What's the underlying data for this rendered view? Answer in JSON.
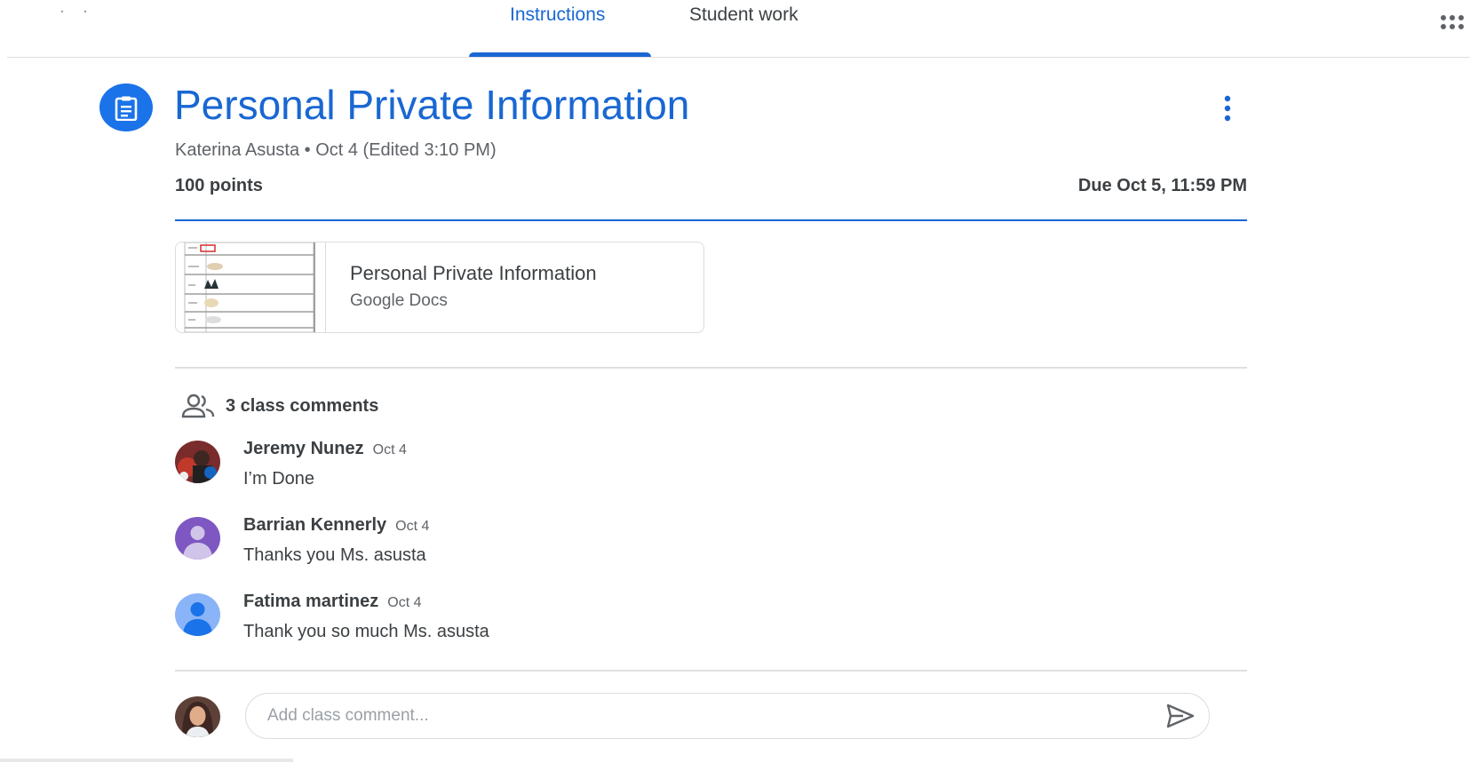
{
  "tabs": {
    "instructions": "Instructions",
    "student_work": "Student work"
  },
  "assignment": {
    "title": "Personal Private Information",
    "byline": "Katerina Asusta • Oct 4 (Edited 3:10 PM)",
    "points": "100 points",
    "due": "Due Oct 5, 11:59 PM"
  },
  "attachment": {
    "title": "Personal Private Information",
    "type": "Google Docs"
  },
  "comments": {
    "header": "3 class comments",
    "items": [
      {
        "author": "Jeremy Nunez",
        "date": "Oct 4",
        "text": "I’m Done"
      },
      {
        "author": "Barrian Kennerly",
        "date": "Oct 4",
        "text": "Thanks you  Ms. asusta"
      },
      {
        "author": "Fatima martinez",
        "date": "Oct 4",
        "text": "Thank you so much Ms. asusta"
      }
    ]
  },
  "composer": {
    "placeholder": "Add class comment..."
  },
  "colors": {
    "accent": "#1967d2",
    "icon_blue": "#1a73e8",
    "avatar_purple": "#7e57c2",
    "avatar_blue": "#8ab4f8"
  },
  "icons": {
    "assignment": "assignment-icon",
    "more": "more-vert-icon",
    "people": "people-icon",
    "send": "send-icon",
    "apps": "apps-grid-icon"
  }
}
